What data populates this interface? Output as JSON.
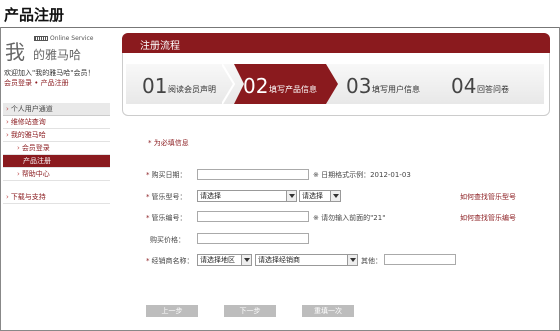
{
  "page_title": "产品注册",
  "logo": {
    "big_char": "我",
    "rest": "的雅马哈",
    "service": "Online Service"
  },
  "welcome": "欢迎加入\"我的雅马哈\"会员！",
  "login_links": {
    "login": "会员登录",
    "sep": " • ",
    "register": "产品注册"
  },
  "nav": {
    "items": [
      {
        "label": "个人用户通道",
        "kind": "head"
      },
      {
        "label": "维修站查询",
        "kind": "top"
      },
      {
        "label": "我的雅马哈",
        "kind": "top"
      },
      {
        "label": "会员登录",
        "kind": "sub"
      },
      {
        "label": "产品注册",
        "kind": "active"
      },
      {
        "label": "帮助中心",
        "kind": "sub"
      },
      {
        "label": "下载与支持",
        "kind": "top"
      }
    ]
  },
  "flow": {
    "title": "注册流程",
    "steps": [
      {
        "num": "01",
        "label": "阅读会员声明"
      },
      {
        "num": "02",
        "label": "填写产品信息"
      },
      {
        "num": "03",
        "label": "填写用户信息"
      },
      {
        "num": "04",
        "label": "回答问卷"
      }
    ],
    "active_step": 2
  },
  "form": {
    "required_note": "* 为必填信息",
    "purchase_date": {
      "label": "购买日期：",
      "value": "",
      "hint": "※ 日期格式示例：2012-01-03"
    },
    "model": {
      "label": "管乐型号：",
      "select1": "请选择",
      "select2": "请选择",
      "help_link": "如何查找管乐型号"
    },
    "serial": {
      "label": "管乐编号：",
      "value": "",
      "hint": "※ 请勿输入前面的\"21\"",
      "help_link": "如何查找管乐编号"
    },
    "price": {
      "label": "购买价格：",
      "value": ""
    },
    "dealer": {
      "label": "经销商名称：",
      "region_select": "请选择地区",
      "dealer_select": "请选择经销商",
      "other_label": "其他：",
      "other_value": ""
    }
  },
  "buttons": {
    "prev": "上一步",
    "next": "下一步",
    "refill": "重填一次"
  },
  "colors": {
    "brand": "#8a1a1e",
    "button": "#bdbdbd"
  }
}
